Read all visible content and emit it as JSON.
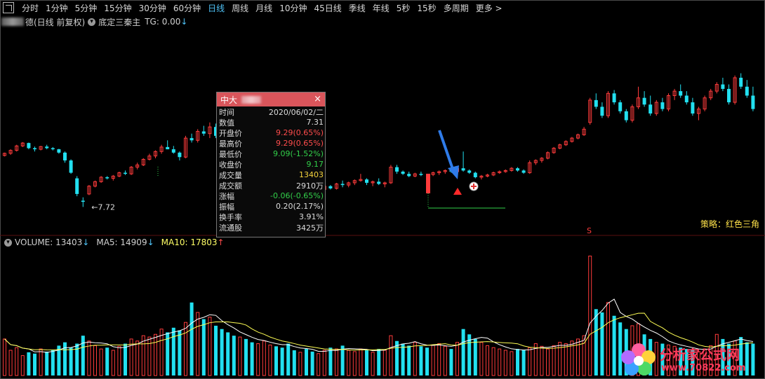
{
  "toolbar": {
    "tabs": [
      "分时",
      "1分钟",
      "5分钟",
      "15分钟",
      "30分钟",
      "60分钟",
      "日线",
      "周线",
      "月线",
      "10分钟",
      "45日线",
      "季线",
      "年线",
      "5秒",
      "15秒",
      "多周期",
      "更多 >"
    ],
    "active": "日线"
  },
  "header": {
    "stock_suffix": "德(日线 前复权)",
    "indicator": "底定三秦主",
    "tg": "TG: 0.00"
  },
  "main_chart": {
    "low_label": "7.72",
    "strategy_label": "策略：红色三角",
    "signal_mark": "S"
  },
  "tooltip": {
    "title": "中大",
    "close": "×",
    "rows": [
      {
        "k": "时间",
        "v": "2020/06/02/二",
        "c": ""
      },
      {
        "k": "数值",
        "v": "7.31",
        "c": ""
      },
      {
        "k": "开盘价",
        "v": "9.29(0.65%)",
        "c": "red"
      },
      {
        "k": "最高价",
        "v": "9.29(0.65%)",
        "c": "red"
      },
      {
        "k": "最低价",
        "v": "9.09(-1.52%)",
        "c": "green"
      },
      {
        "k": "收盘价",
        "v": "9.17",
        "c": "green"
      },
      {
        "k": "成交量",
        "v": "13403",
        "c": "yellow"
      },
      {
        "k": "成交额",
        "v": "2910万",
        "c": ""
      },
      {
        "k": "涨幅",
        "v": "-0.06(-0.65%)",
        "c": "green"
      },
      {
        "k": "振幅",
        "v": "0.20(2.17%)",
        "c": ""
      },
      {
        "k": "换手率",
        "v": "3.91%",
        "c": ""
      },
      {
        "k": "流通股",
        "v": "3425万",
        "c": ""
      }
    ]
  },
  "volume": {
    "label": "VOLUME: 13403",
    "ma5": "MA5: 14909",
    "ma10": "MA10: 17803"
  },
  "watermark": {
    "name": "分析家公式网",
    "url": "www.70822.com"
  },
  "colors": {
    "up": "#ff3b3b",
    "down": "#22e0f0",
    "ma5": "#ffffff",
    "ma10": "#ffff55",
    "accent_tab": "#4fc3f7",
    "tooltip_header": "#d9555b"
  },
  "candles": [
    [
      10.02,
      10.15,
      9.98,
      10.12
    ],
    [
      10.12,
      10.3,
      10.05,
      10.25
    ],
    [
      10.25,
      10.5,
      10.2,
      10.45
    ],
    [
      10.45,
      10.62,
      10.4,
      10.58
    ],
    [
      10.58,
      10.6,
      10.3,
      10.35
    ],
    [
      10.35,
      10.42,
      10.2,
      10.3
    ],
    [
      10.3,
      10.45,
      10.25,
      10.42
    ],
    [
      10.42,
      10.5,
      10.3,
      10.35
    ],
    [
      10.35,
      10.4,
      10.25,
      10.3
    ],
    [
      10.3,
      10.32,
      10.1,
      10.15
    ],
    [
      10.15,
      10.2,
      9.7,
      9.8
    ],
    [
      9.8,
      9.85,
      9.2,
      9.25
    ],
    [
      9.0,
      9.1,
      8.2,
      8.3
    ],
    [
      8.0,
      8.15,
      7.72,
      7.95
    ],
    [
      8.3,
      8.7,
      8.25,
      8.65
    ],
    [
      8.65,
      8.9,
      8.6,
      8.85
    ],
    [
      8.85,
      9.1,
      8.8,
      9.05
    ],
    [
      9.05,
      9.1,
      8.95,
      9.0
    ],
    [
      9.0,
      9.15,
      8.9,
      9.1
    ],
    [
      9.1,
      9.3,
      9.05,
      9.25
    ],
    [
      9.25,
      9.35,
      9.15,
      9.2
    ],
    [
      9.2,
      9.55,
      9.15,
      9.5
    ],
    [
      9.5,
      9.7,
      9.4,
      9.6
    ],
    [
      9.6,
      9.9,
      9.55,
      9.85
    ],
    [
      9.85,
      10.1,
      9.8,
      10.0
    ],
    [
      10.0,
      10.25,
      9.9,
      10.2
    ],
    [
      10.2,
      10.5,
      10.1,
      10.4
    ],
    [
      10.4,
      10.7,
      10.3,
      10.3
    ],
    [
      10.3,
      10.45,
      10.1,
      10.15
    ],
    [
      10.15,
      10.2,
      9.8,
      9.95
    ],
    [
      9.95,
      10.9,
      9.9,
      10.8
    ],
    [
      10.8,
      11.0,
      10.6,
      10.7
    ],
    [
      10.7,
      11.2,
      10.6,
      11.1
    ],
    [
      11.1,
      11.35,
      10.9,
      11.0
    ],
    [
      11.0,
      11.5,
      10.8,
      11.3
    ],
    [
      11.3,
      11.45,
      10.8,
      10.9
    ],
    [
      10.9,
      11.2,
      10.5,
      10.6
    ],
    [
      10.6,
      10.8,
      10.2,
      10.3
    ],
    [
      10.3,
      10.4,
      9.7,
      9.8
    ],
    [
      9.8,
      10.2,
      9.75,
      10.1
    ],
    [
      9.7,
      9.8,
      9.2,
      9.3
    ],
    [
      9.3,
      9.4,
      8.7,
      8.8
    ],
    [
      8.8,
      9.2,
      8.7,
      9.1
    ],
    [
      9.1,
      9.4,
      9.0,
      9.3
    ],
    [
      9.3,
      9.6,
      9.2,
      9.5
    ],
    [
      9.5,
      9.65,
      9.3,
      9.4
    ],
    [
      9.4,
      9.5,
      9.1,
      9.2
    ],
    [
      9.2,
      9.3,
      8.9,
      9.0
    ],
    [
      9.0,
      9.1,
      8.6,
      8.7
    ],
    [
      8.7,
      8.9,
      8.5,
      8.8
    ],
    [
      8.8,
      8.85,
      8.6,
      8.7
    ],
    [
      8.7,
      8.75,
      8.4,
      8.45
    ],
    [
      8.45,
      8.6,
      8.3,
      8.5
    ],
    [
      8.5,
      8.7,
      8.45,
      8.65
    ],
    [
      8.65,
      8.7,
      8.5,
      8.55
    ],
    [
      8.55,
      8.8,
      8.5,
      8.75
    ],
    [
      8.75,
      8.9,
      8.6,
      8.7
    ],
    [
      8.7,
      8.85,
      8.6,
      8.8
    ],
    [
      8.8,
      8.95,
      8.7,
      8.9
    ],
    [
      8.9,
      9.2,
      8.85,
      8.95
    ],
    [
      8.95,
      9.0,
      8.7,
      8.8
    ],
    [
      8.8,
      8.9,
      8.65,
      8.85
    ],
    [
      8.85,
      9.0,
      8.7,
      8.75
    ],
    [
      8.75,
      8.85,
      8.6,
      8.8
    ],
    [
      8.8,
      9.6,
      8.75,
      9.5
    ],
    [
      9.5,
      9.6,
      9.2,
      9.3
    ],
    [
      9.3,
      9.35,
      9.15,
      9.2
    ],
    [
      9.2,
      9.3,
      9.05,
      9.1
    ],
    [
      9.1,
      9.25,
      9.05,
      9.2
    ],
    [
      9.2,
      9.3,
      9.1,
      9.15
    ],
    [
      9.29,
      9.29,
      9.09,
      9.17
    ],
    [
      9.17,
      9.3,
      9.1,
      9.25
    ],
    [
      9.25,
      9.35,
      9.15,
      9.3
    ],
    [
      9.3,
      9.4,
      9.2,
      9.35
    ],
    [
      9.35,
      9.4,
      9.25,
      9.3
    ],
    [
      9.3,
      9.5,
      9.25,
      9.45
    ],
    [
      9.45,
      10.2,
      9.3,
      9.35
    ],
    [
      9.35,
      9.4,
      9.2,
      9.25
    ],
    [
      9.25,
      9.3,
      9.0,
      9.05
    ],
    [
      9.05,
      9.15,
      8.95,
      9.1
    ],
    [
      9.1,
      9.2,
      9.05,
      9.15
    ],
    [
      9.15,
      9.3,
      9.1,
      9.25
    ],
    [
      9.25,
      9.35,
      9.2,
      9.3
    ],
    [
      9.3,
      9.4,
      9.25,
      9.35
    ],
    [
      9.35,
      9.5,
      9.3,
      9.45
    ],
    [
      9.45,
      9.5,
      9.3,
      9.35
    ],
    [
      9.35,
      9.4,
      9.2,
      9.25
    ],
    [
      9.25,
      9.8,
      9.2,
      9.7
    ],
    [
      9.7,
      9.85,
      9.6,
      9.8
    ],
    [
      9.8,
      9.95,
      9.7,
      9.9
    ],
    [
      9.9,
      10.2,
      9.85,
      10.15
    ],
    [
      10.15,
      10.4,
      10.1,
      10.35
    ],
    [
      10.35,
      10.55,
      10.3,
      10.5
    ],
    [
      10.5,
      10.7,
      10.45,
      10.65
    ],
    [
      10.65,
      10.85,
      10.6,
      10.8
    ],
    [
      10.8,
      11.0,
      10.75,
      10.95
    ],
    [
      10.95,
      11.3,
      10.9,
      11.2
    ],
    [
      11.5,
      12.6,
      11.4,
      12.5
    ],
    [
      12.5,
      12.8,
      12.1,
      12.2
    ],
    [
      12.2,
      12.4,
      11.7,
      11.8
    ],
    [
      11.8,
      12.9,
      11.7,
      12.8
    ],
    [
      12.8,
      12.95,
      12.3,
      12.4
    ],
    [
      12.4,
      12.5,
      11.9,
      12.0
    ],
    [
      12.0,
      12.1,
      11.5,
      11.6
    ],
    [
      11.6,
      12.3,
      11.5,
      12.2
    ],
    [
      12.2,
      13.1,
      12.1,
      12.6
    ],
    [
      12.6,
      12.9,
      12.2,
      12.3
    ],
    [
      12.3,
      12.7,
      11.8,
      11.9
    ],
    [
      11.9,
      12.5,
      11.8,
      12.4
    ],
    [
      12.4,
      12.6,
      12.0,
      12.1
    ],
    [
      12.1,
      12.8,
      12.0,
      12.7
    ],
    [
      12.7,
      13.0,
      12.5,
      12.9
    ],
    [
      12.9,
      13.2,
      12.6,
      12.7
    ],
    [
      12.7,
      12.9,
      12.3,
      12.4
    ],
    [
      12.4,
      12.6,
      11.8,
      11.9
    ],
    [
      11.9,
      12.2,
      11.6,
      12.1
    ],
    [
      12.1,
      12.7,
      12.0,
      12.6
    ],
    [
      12.6,
      13.0,
      12.5,
      12.9
    ],
    [
      12.9,
      13.3,
      12.8,
      13.2
    ],
    [
      13.2,
      13.5,
      12.9,
      13.0
    ],
    [
      13.0,
      13.2,
      12.3,
      12.4
    ],
    [
      12.4,
      13.6,
      12.3,
      13.5
    ],
    [
      13.5,
      13.7,
      13.0,
      13.1
    ],
    [
      13.1,
      13.4,
      12.6,
      12.7
    ],
    [
      12.7,
      13.1,
      12.0,
      12.1
    ]
  ],
  "volumes": [
    55,
    38,
    42,
    30,
    35,
    33,
    40,
    36,
    38,
    45,
    50,
    42,
    48,
    60,
    52,
    45,
    40,
    42,
    38,
    44,
    48,
    55,
    52,
    60,
    58,
    62,
    70,
    65,
    72,
    68,
    80,
    110,
    95,
    85,
    88,
    75,
    70,
    65,
    60,
    58,
    55,
    50,
    48,
    52,
    46,
    44,
    42,
    48,
    38,
    35,
    40,
    36,
    33,
    38,
    42,
    40,
    45,
    38,
    36,
    40,
    38,
    35,
    40,
    38,
    60,
    52,
    48,
    45,
    50,
    44,
    42,
    46,
    48,
    44,
    40,
    50,
    70,
    62,
    55,
    50,
    45,
    42,
    40,
    38,
    36,
    40,
    38,
    42,
    48,
    44,
    40,
    45,
    50,
    48,
    52,
    55,
    60,
    180,
    100,
    95,
    110,
    90,
    80,
    70,
    75,
    78,
    62,
    55,
    50,
    48,
    46,
    44,
    42,
    40,
    38,
    36,
    40,
    45,
    62,
    55,
    48,
    52,
    58,
    50,
    48
  ]
}
